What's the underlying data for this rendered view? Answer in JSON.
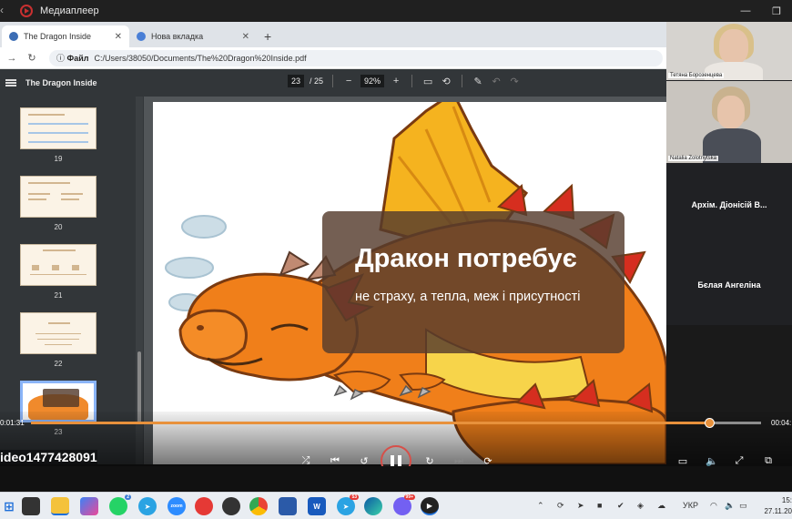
{
  "app": {
    "title": "Медиаплеер"
  },
  "browser": {
    "tabs": [
      {
        "label": "The Dragon Inside",
        "active": true
      },
      {
        "label": "Нова вкладка",
        "active": false
      }
    ],
    "address": {
      "chip": "Файл",
      "url": "C:/Users/38050/Documents/The%20Dragon%20Inside.pdf"
    }
  },
  "pdf": {
    "title": "The Dragon Inside",
    "page_current": "23",
    "page_total": "/ 25",
    "zoom": "92%",
    "thumbnails": [
      {
        "num": "19"
      },
      {
        "num": "20"
      },
      {
        "num": "21"
      },
      {
        "num": "22"
      },
      {
        "num": "23",
        "selected": true
      }
    ]
  },
  "slide": {
    "title": "Дракон потребує",
    "subtitle": "не страху, а тепла, меж і присутності"
  },
  "participants": [
    {
      "name": "Тетяна Борозенцева"
    },
    {
      "name": "Natalia Zolotnytska"
    },
    {
      "name": "Архім. Діонісій В..."
    },
    {
      "name": "Бєлая Ангеліна"
    }
  ],
  "player": {
    "time_elapsed": "0:01:31",
    "time_end": "00:04:",
    "progress": 0.93,
    "video_label": "ideo1477428091"
  },
  "taskbar": {
    "badges": {
      "whatsapp": "2",
      "telegram2": "53",
      "viber": "99+"
    },
    "lang": "УКР",
    "time": "15:",
    "date": "27.11.20"
  },
  "colors": {
    "accent": "#e8913c",
    "play_ring": "#d6504a",
    "pdf_toolbar": "#323639"
  }
}
